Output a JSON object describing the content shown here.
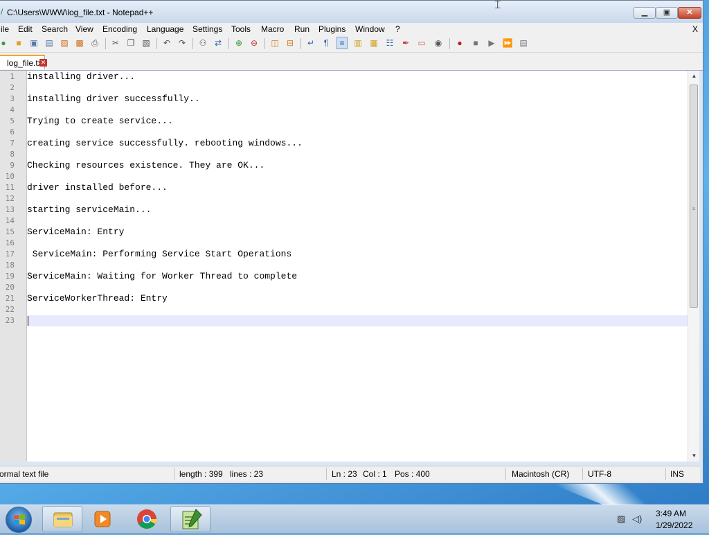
{
  "window": {
    "title": "C:\\Users\\WWW\\log_file.txt - Notepad++"
  },
  "menu": {
    "items": [
      "ile",
      "Edit",
      "Search",
      "View",
      "Encoding",
      "Language",
      "Settings",
      "Tools",
      "Macro",
      "Run",
      "Plugins",
      "Window",
      "?"
    ],
    "close_label": "X"
  },
  "toolbar": {
    "icons": [
      "new-file-icon",
      "open-file-icon",
      "save-icon",
      "save-all-icon",
      "close-icon",
      "close-all-icon",
      "print-icon",
      "cut-icon",
      "copy-icon",
      "paste-icon",
      "undo-icon",
      "redo-icon",
      "find-icon",
      "replace-icon",
      "zoom-in-icon",
      "zoom-out-icon",
      "sync-vertical-icon",
      "sync-horizontal-icon",
      "word-wrap-icon",
      "show-all-chars-icon",
      "indent-guide-icon",
      "user-language-icon",
      "doc-map-icon",
      "function-list-icon",
      "folder-workspace-icon",
      "monitoring-icon",
      "record-macro-icon",
      "stop-record-icon",
      "play-macro-icon",
      "run-macro-multiple-icon",
      "save-macro-icon"
    ]
  },
  "tab": {
    "label": "log_file.txt"
  },
  "editor": {
    "line_numbers": [
      "1",
      "2",
      "3",
      "4",
      "5",
      "6",
      "7",
      "8",
      "9",
      "10",
      "11",
      "12",
      "13",
      "14",
      "15",
      "16",
      "17",
      "18",
      "19",
      "20",
      "21",
      "22",
      "23"
    ],
    "lines": [
      "installing driver...",
      "",
      "installing driver successfully..",
      "",
      "Trying to create service...",
      "",
      "creating service successfully. rebooting windows...",
      "",
      "Checking resources existence. They are OK...",
      "",
      "driver installed before...",
      "",
      "starting serviceMain...",
      "",
      "ServiceMain: Entry",
      "",
      " ServiceMain: Performing Service Start Operations",
      "",
      "ServiceMain: Waiting for Worker Thread to complete",
      "",
      "ServiceWorkerThread: Entry",
      "",
      ""
    ],
    "current_line": 23
  },
  "status": {
    "file_type": "ormal text file",
    "length": "length : 399",
    "lines": "lines : 23",
    "ln": "Ln : 23",
    "col": "Col : 1",
    "pos": "Pos : 400",
    "eol": "Macintosh (CR)",
    "encoding": "UTF-8",
    "mode": "INS"
  },
  "taskbar": {
    "apps": [
      "file-explorer-icon",
      "media-player-icon",
      "chrome-icon",
      "notepad-plus-plus-icon"
    ],
    "time": "3:49 AM",
    "date": "1/29/2022"
  }
}
